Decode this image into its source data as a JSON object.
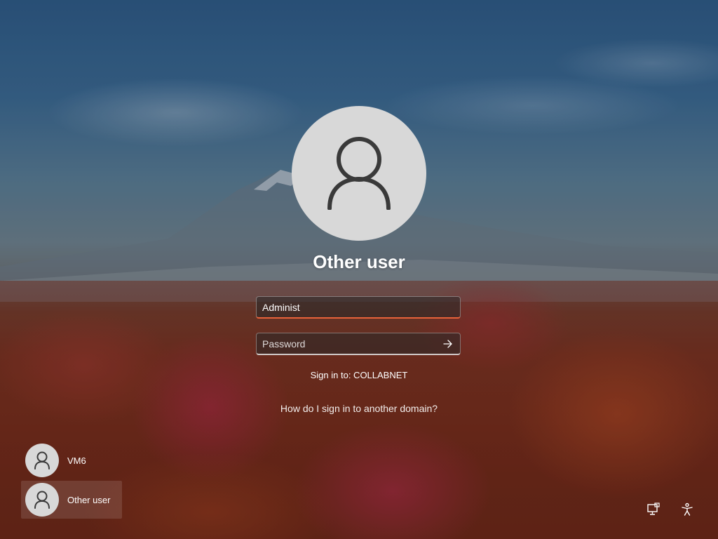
{
  "login": {
    "selected_user": "Other user",
    "username_value": "Administ",
    "password_placeholder": "Password",
    "sign_in_to": "Sign in to: COLLABNET",
    "domain_help_link": "How do I sign in to another domain?"
  },
  "user_list": [
    {
      "name": "VM6",
      "selected": false
    },
    {
      "name": "Other user",
      "selected": true
    }
  ],
  "icons": {
    "submit": "arrow-right-icon",
    "network": "network-icon",
    "accessibility": "accessibility-icon",
    "avatar": "person-icon"
  },
  "colors": {
    "focus_underline": "#e8623a",
    "avatar_bg": "#d8d8d8"
  }
}
